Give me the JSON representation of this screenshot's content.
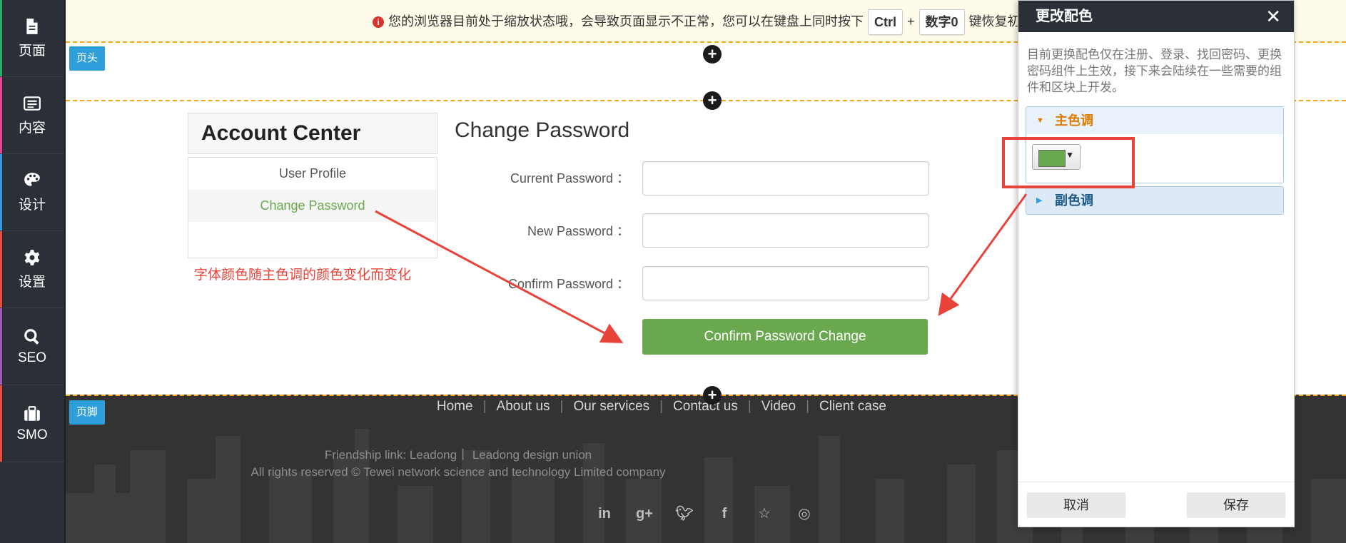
{
  "sidebar": {
    "items": [
      {
        "label": "页面",
        "icon": "page-icon",
        "color": "#27ae60"
      },
      {
        "label": "内容",
        "icon": "list-icon",
        "color": "#e84393"
      },
      {
        "label": "设计",
        "icon": "palette-icon",
        "color": "#3498db"
      },
      {
        "label": "设置",
        "icon": "gear-icon",
        "color": "#e74c3c"
      },
      {
        "label": "SEO",
        "icon": "search-icon",
        "color": "#9b59b6"
      },
      {
        "label": "SMO",
        "icon": "briefcase-icon",
        "color": "#e74c3c"
      }
    ]
  },
  "warning": {
    "text_before": "您的浏览器目前处于缩放状态哦，会导致页面显示不正常，您可以在键盘上同时按下",
    "key1": "Ctrl",
    "plus": "+",
    "key2": "数字0",
    "text_after": "键恢复初始"
  },
  "header_tag": "页头",
  "footer_tag": "页脚",
  "account": {
    "title": "Account Center",
    "items": [
      "User Profile",
      "Change Password"
    ]
  },
  "annotation": "字体颜色随主色调的颜色变化而变化",
  "form": {
    "title": "Change Password",
    "current_label": "Current Password ：",
    "new_label": "New Password ：",
    "confirm_label": "Confirm Password ：",
    "submit": "Confirm Password Change"
  },
  "footer": {
    "nav": [
      "Home",
      "About us",
      "Our services",
      "Contact us",
      "Video",
      "Client case"
    ],
    "friendship": "Friendship link: Leadong丨 Leadong design union",
    "copyright": "All rights reserved © Tewei network science and technology Limited company",
    "social_icons": [
      "linkedin-icon",
      "google-plus-icon",
      "twitter-icon",
      "facebook-icon",
      "star-icon",
      "weibo-icon"
    ]
  },
  "dialog": {
    "title": "更改配色",
    "description": "目前更换配色仅在注册、登录、找回密码、更换密码组件上生效，接下来会陆续在一些需要的组件和区块上开发。",
    "primary_label": "主色调",
    "secondary_label": "副色调",
    "primary_color": "#6aa84f",
    "cancel": "取消",
    "save": "保存"
  },
  "colors": {
    "accent_green": "#6aa84f",
    "tag_blue": "#2f9fdc",
    "annotation_red": "#e8443a",
    "dashed_orange": "#f3a712"
  }
}
